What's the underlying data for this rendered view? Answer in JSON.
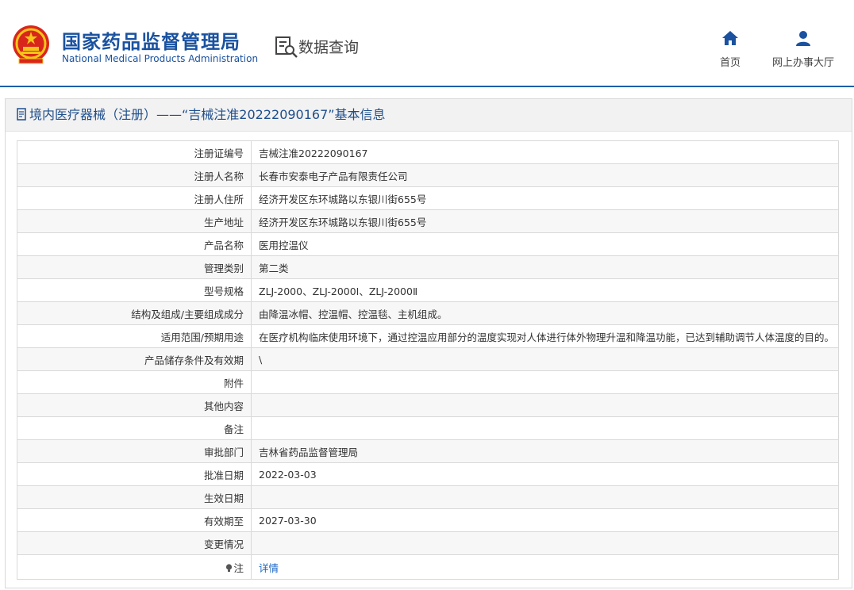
{
  "header": {
    "org_cn": "国家药品监督管理局",
    "org_en": "National Medical Products Administration",
    "query_label": "数据查询",
    "nav": [
      {
        "label": "首页",
        "icon": "home-icon"
      },
      {
        "label": "网上办事大厅",
        "icon": "user-icon"
      }
    ]
  },
  "panel": {
    "title": "境内医疗器械（注册）——“吉械注准20222090167”基本信息"
  },
  "rows": [
    {
      "key": "注册证编号",
      "value": "吉械注准20222090167"
    },
    {
      "key": "注册人名称",
      "value": "长春市安泰电子产品有限责任公司"
    },
    {
      "key": "注册人住所",
      "value": "经济开发区东环城路以东银川街655号"
    },
    {
      "key": "生产地址",
      "value": "经济开发区东环城路以东银川街655号"
    },
    {
      "key": "产品名称",
      "value": "医用控温仪"
    },
    {
      "key": "管理类别",
      "value": "第二类"
    },
    {
      "key": "型号规格",
      "value": "ZLJ-2000、ZLJ-2000Ⅰ、ZLJ-2000Ⅱ"
    },
    {
      "key": "结构及组成/主要组成成分",
      "value": "由降温冰帽、控温帽、控温毯、主机组成。"
    },
    {
      "key": "适用范围/预期用途",
      "value": "在医疗机构临床使用环境下，通过控温应用部分的温度实现对人体进行体外物理升温和降温功能，已达到辅助调节人体温度的目的。"
    },
    {
      "key": "产品储存条件及有效期",
      "value": "\\"
    },
    {
      "key": "附件",
      "value": ""
    },
    {
      "key": "其他内容",
      "value": ""
    },
    {
      "key": "备注",
      "value": ""
    },
    {
      "key": "审批部门",
      "value": "吉林省药品监督管理局"
    },
    {
      "key": "批准日期",
      "value": "2022-03-03"
    },
    {
      "key": "生效日期",
      "value": ""
    },
    {
      "key": "有效期至",
      "value": "2027-03-30"
    },
    {
      "key": "变更情况",
      "value": ""
    }
  ],
  "note_row": {
    "key": "注",
    "link": "详情",
    "icon": "lightbulb-icon"
  },
  "colors": {
    "brand": "#1a52a0",
    "link": "#1a66c4",
    "header_rule": "#1c5fa8"
  }
}
